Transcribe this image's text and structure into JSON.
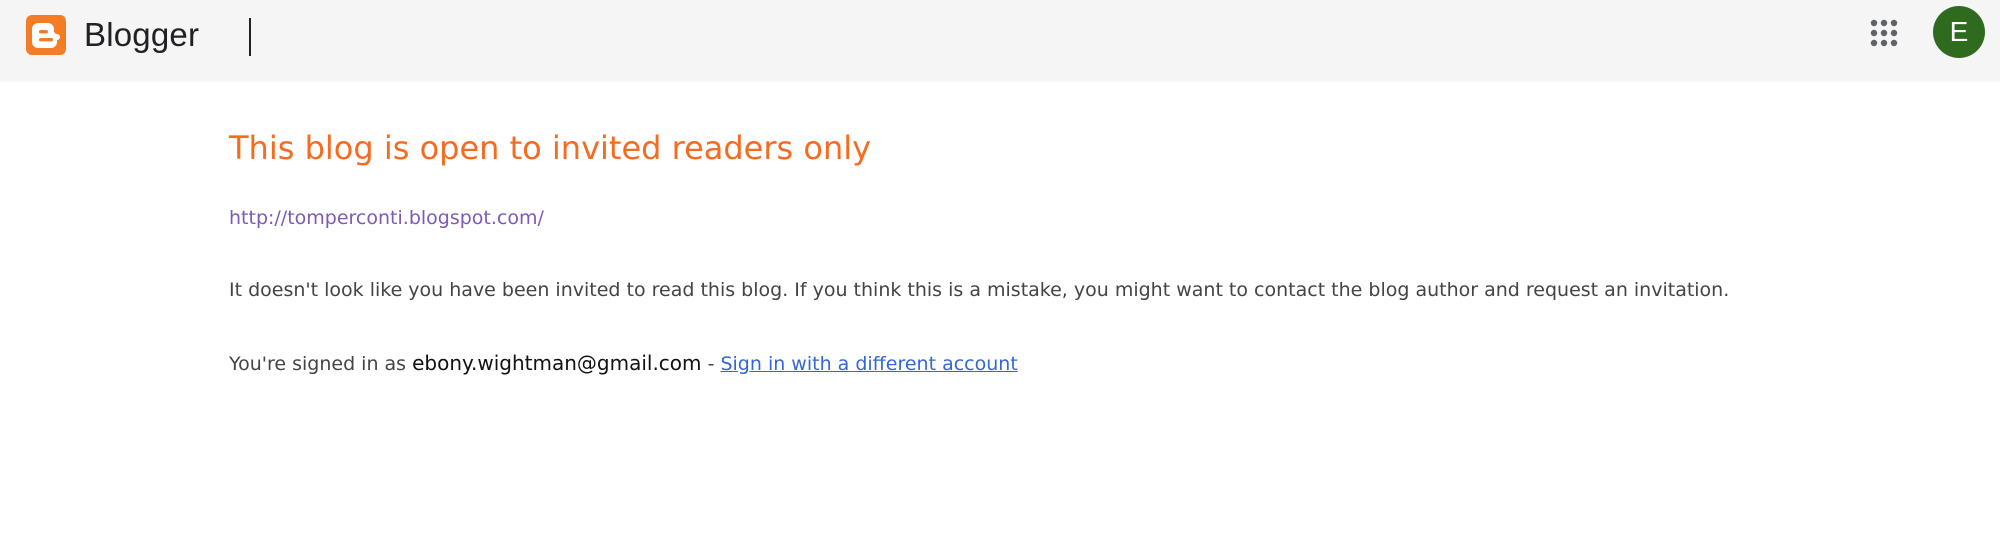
{
  "header": {
    "brand_name": "Blogger",
    "logo_icon": "blogger-logo-icon",
    "apps_icon": "apps-grid-icon",
    "avatar_initial": "E",
    "avatar_color": "#2e6b1e",
    "brand_color": "#f57c25"
  },
  "main": {
    "title": "This blog is open to invited readers only",
    "blog_url": "http://tomperconti.blogspot.com/",
    "message": "It doesn't look like you have been invited to read this blog. If you think this is a mistake, you might want to contact the blog author and request an invitation.",
    "signed_in_prefix": "You're signed in as ",
    "email": "ebony.wightman@gmail.com",
    "separator": " - ",
    "switch_account_link": "Sign in with a different account",
    "title_color": "#f56b20",
    "link_color": "#3367d6"
  }
}
